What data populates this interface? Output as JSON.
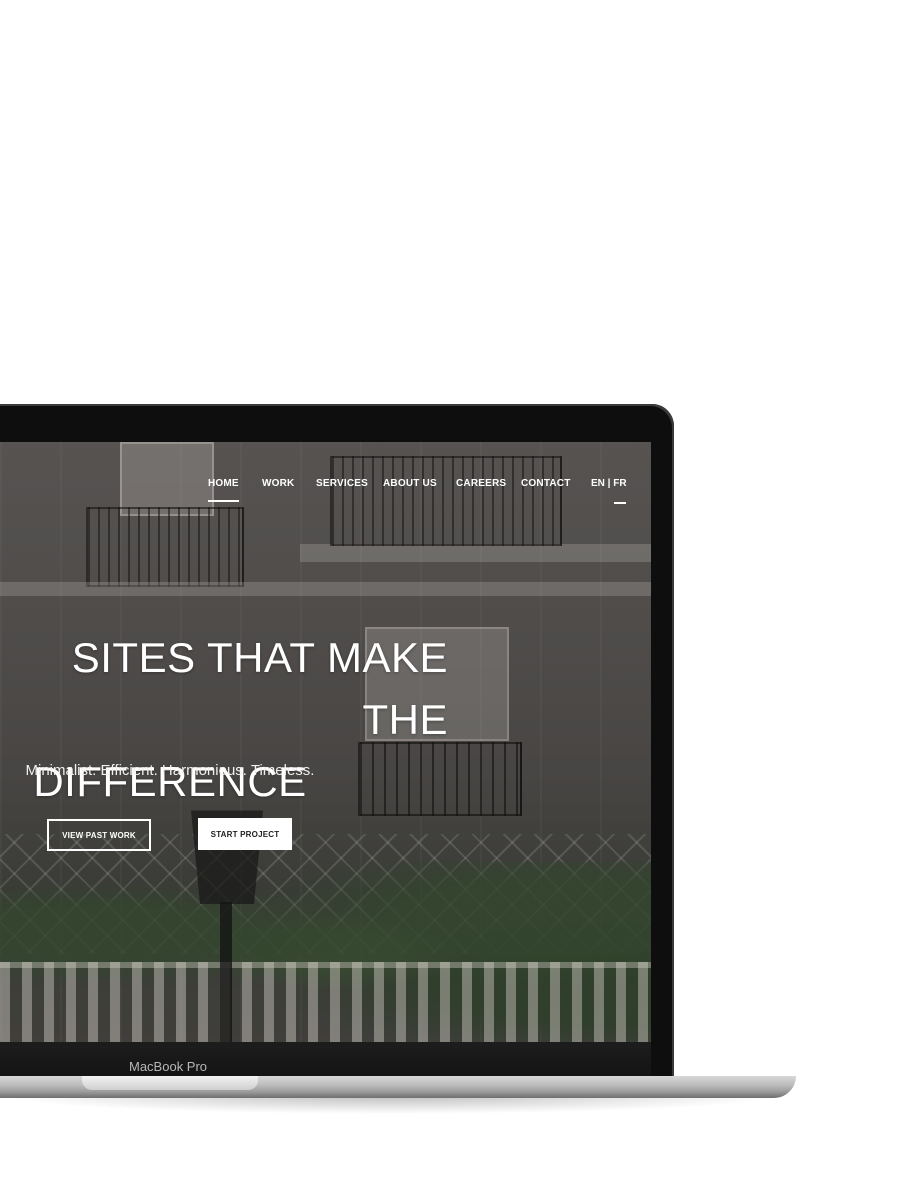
{
  "device": {
    "label": "MacBook Pro"
  },
  "nav": {
    "items": [
      {
        "label": "HOME",
        "active": true
      },
      {
        "label": "WORK",
        "active": false
      },
      {
        "label": "SERVICES",
        "active": false
      },
      {
        "label": "ABOUT US",
        "active": false
      },
      {
        "label": "CAREERS",
        "active": false
      },
      {
        "label": "CONTACT",
        "active": false
      }
    ],
    "language": {
      "label": "EN | FR",
      "current": "FR"
    }
  },
  "hero": {
    "title_line1": "SITES THAT MAKE THE",
    "title_line2": "DIFFERENCE",
    "subtitle": "Minimalist. Efficient. Harmonious. Timeless.",
    "primary_button": "VIEW PAST WORK",
    "secondary_button": "START PROJECT"
  },
  "colors": {
    "text": "#ffffff",
    "overlay": "#282626",
    "button_fill": "#ffffff",
    "bezel": "#0e0e0e"
  }
}
